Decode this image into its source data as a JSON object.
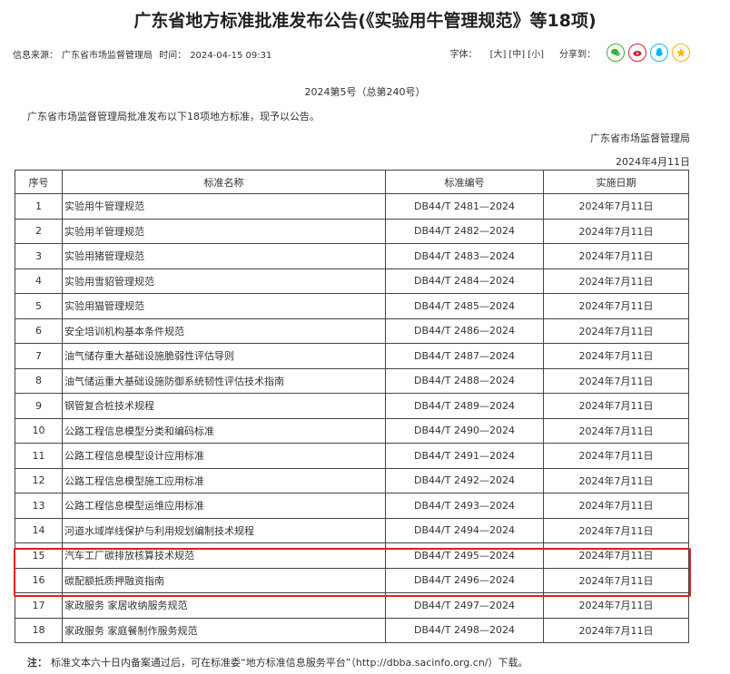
{
  "article": {
    "title": "广东省地方标准批准发布公告(《实验用牛管理规范》等18项)",
    "meta": {
      "source_label": "信息来源：",
      "source": "广东省市场监督管理局",
      "time_label": "时间：",
      "time": "2024-04-15 09:31"
    },
    "tools": {
      "font_label": "字体：",
      "sizes": [
        "[大]",
        "[中]",
        "[小]"
      ],
      "share_label": "分享到：",
      "share_icons": [
        "wechat-icon",
        "weibo-icon",
        "qq-icon",
        "qzone-icon"
      ],
      "share_colors": [
        "#3cb034",
        "#e6162d",
        "#12b7f5",
        "#f8b500"
      ]
    },
    "issue": "2024第5号（总第240号）",
    "intro": "广东省市场监督管理局批准发布以下18项地方标准，现予以公告。",
    "org": "广东省市场监督管理局",
    "date": "2024年4月11日",
    "table": {
      "headers": [
        "序号",
        "标准名称",
        "标准编号",
        "实施日期"
      ],
      "rows": [
        [
          "1",
          "实验用牛管理规范",
          "DB44/T 2481—2024",
          "2024年7月11日"
        ],
        [
          "2",
          "实验用羊管理规范",
          "DB44/T 2482—2024",
          "2024年7月11日"
        ],
        [
          "3",
          "实验用猪管理规范",
          "DB44/T 2483—2024",
          "2024年7月11日"
        ],
        [
          "4",
          "实验用雪貂管理规范",
          "DB44/T 2484—2024",
          "2024年7月11日"
        ],
        [
          "5",
          "实验用猫管理规范",
          "DB44/T 2485—2024",
          "2024年7月11日"
        ],
        [
          "6",
          "安全培训机构基本条件规范",
          "DB44/T 2486—2024",
          "2024年7月11日"
        ],
        [
          "7",
          "油气储存重大基础设施脆弱性评估导则",
          "DB44/T 2487—2024",
          "2024年7月11日"
        ],
        [
          "8",
          "油气储运重大基础设施防御系统韧性评估技术指南",
          "DB44/T 2488—2024",
          "2024年7月11日"
        ],
        [
          "9",
          "钢管复合桩技术规程",
          "DB44/T 2489—2024",
          "2024年7月11日"
        ],
        [
          "10",
          "公路工程信息模型分类和编码标准",
          "DB44/T 2490—2024",
          "2024年7月11日"
        ],
        [
          "11",
          "公路工程信息模型设计应用标准",
          "DB44/T 2491—2024",
          "2024年7月11日"
        ],
        [
          "12",
          "公路工程信息模型施工应用标准",
          "DB44/T 2492—2024",
          "2024年7月11日"
        ],
        [
          "13",
          "公路工程信息模型运维应用标准",
          "DB44/T 2493—2024",
          "2024年7月11日"
        ],
        [
          "14",
          "河道水域岸线保护与利用规划编制技术规程",
          "DB44/T 2494—2024",
          "2024年7月11日"
        ],
        [
          "15",
          "汽车工厂碳排放核算技术规范",
          "DB44/T 2495—2024",
          "2024年7月11日"
        ],
        [
          "16",
          "碳配额抵质押融资指南",
          "DB44/T 2496—2024",
          "2024年7月11日"
        ],
        [
          "17",
          "家政服务 家居收纳服务规范",
          "DB44/T 2497—2024",
          "2024年7月11日"
        ],
        [
          "18",
          "家政服务 家庭餐制作服务规范",
          "DB44/T 2498—2024",
          "2024年7月11日"
        ]
      ]
    },
    "note": {
      "label": "注：",
      "text": "标准文本六十日内备案通过后，可在标准委“地方标准信息服务平台”（http://dbba.sacinfo.org.cn/）下载。"
    }
  }
}
